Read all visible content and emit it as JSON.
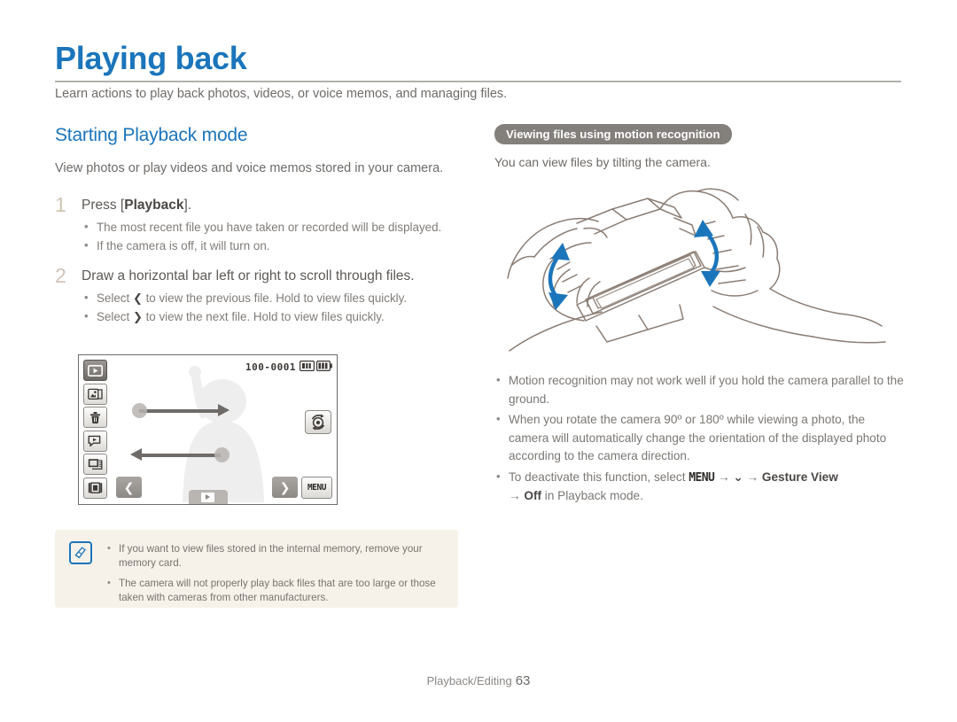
{
  "page": {
    "title": "Playing back",
    "subtitle": "Learn actions to play back photos, videos, or voice memos, and managing files.",
    "footer_section": "Playback/Editing",
    "footer_page": "63",
    "accent_color": "#1b75bb",
    "body_color": "#6e6a67",
    "memo_bg": "#f6f2e9"
  },
  "left": {
    "heading": "Starting Playback mode",
    "lead": "View photos or play videos and voice memos stored in your camera.",
    "steps": [
      {
        "number": "1",
        "title_prefix": "Press [",
        "title_bold": "Playback",
        "title_suffix": "].",
        "bullets": [
          "The most recent file you have taken or recorded will be displayed.",
          "If the camera is off, it will turn on."
        ]
      },
      {
        "number": "2",
        "title": "Draw a horizontal bar left or right to scroll through files.",
        "bullets": [
          {
            "prefix": "Select ",
            "glyph": "❮",
            "suffix": " to view the previous file. Hold to view files quickly."
          },
          {
            "prefix": "Select ",
            "glyph": "❯",
            "suffix": " to view the next file. Hold to view files quickly."
          }
        ]
      }
    ],
    "lcd": {
      "file_number": "100-0001",
      "card_icon": "memory-card-icon",
      "battery_icon": "battery-icon",
      "side_buttons": [
        {
          "name": "playback-mode-icon",
          "active": true
        },
        {
          "name": "smart-album-icon",
          "active": false
        },
        {
          "name": "delete-icon",
          "active": false
        },
        {
          "name": "slideshow-icon",
          "active": false
        },
        {
          "name": "multi-slideshow-icon",
          "active": false
        },
        {
          "name": "thumbnail-view-icon",
          "active": false
        }
      ],
      "rotate_button_icon": "rotate-photo-icon",
      "prev_label": "❮",
      "next_label": "❯",
      "menu_label": "MENU"
    },
    "memo": {
      "icon": "note-pen-icon",
      "items": [
        "If you want to view files stored in the internal memory, remove your memory card.",
        "The camera will not properly play back files that are too large or those taken with cameras from other manufacturers."
      ]
    }
  },
  "right": {
    "tagline": "Viewing files using motion recognition",
    "lead": "You can view files by tilting the camera.",
    "illustration": "hands-holding-camera-tilt-diagram",
    "bullets": [
      "Motion recognition may not work well if you hold the camera parallel to the ground.",
      "When you rotate the camera 90º or 180º while viewing a photo, the camera will automatically change the orientation of the displayed photo according to the camera direction."
    ],
    "deactivate": {
      "prefix": "To deactivate this function, select ",
      "menu": "MENU",
      "arrow": "→",
      "down_glyph": "⌄",
      "option": "Gesture View",
      "value": "Off",
      "suffix": " in Playback mode."
    }
  }
}
